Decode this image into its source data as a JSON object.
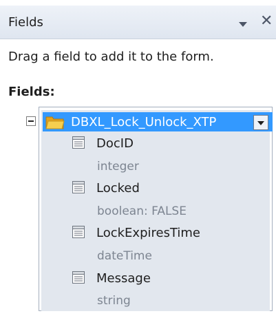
{
  "pane": {
    "title": "Fields",
    "instruction": "Drag a field to add it to the form.",
    "section_label": "Fields:"
  },
  "tree": {
    "root_label": "DBXL_Lock_Unlock_XTP",
    "fields": [
      {
        "name": "DocID",
        "type": "integer"
      },
      {
        "name": "Locked",
        "type": "boolean: FALSE"
      },
      {
        "name": "LockExpiresTime",
        "type": "dateTime"
      },
      {
        "name": "Message",
        "type": "string"
      }
    ]
  },
  "icons": {
    "pane_menu": "chevron-down-icon",
    "close": "close-icon",
    "folder": "folder-icon",
    "field": "field-icon"
  },
  "colors": {
    "selection": "#3399ff",
    "tree_background": "#e2e7ee",
    "secondary_text": "#7d8591"
  }
}
